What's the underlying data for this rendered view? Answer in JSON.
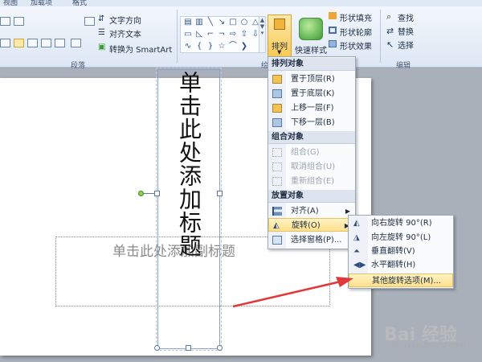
{
  "tabs": [
    "视图",
    "加载项",
    "格式"
  ],
  "ribbon": {
    "paragraph": {
      "text_direction": "文字方向",
      "align_text": "对齐文本",
      "convert_smartart": "转换为 SmartArt",
      "group_label": "段落"
    },
    "drawing": {
      "arrange": "排列",
      "quick_styles": "快速样式",
      "shape_fill": "形状填充",
      "shape_outline": "形状轮廓",
      "shape_effects": "形状效果",
      "group_label": "绘"
    },
    "editing": {
      "find": "查找",
      "replace": "替换",
      "select": "选择",
      "group_label": "编辑"
    }
  },
  "slide": {
    "title_placeholder": "单击此处添加标题",
    "subtitle_placeholder": "单击此处添加副标题"
  },
  "menu": {
    "sections": [
      {
        "header": "排列对象",
        "items": [
          {
            "label": "置于顶层(R)",
            "icon": "bring-to-front-icon",
            "enabled": true
          },
          {
            "label": "置于底层(K)",
            "icon": "send-to-back-icon",
            "enabled": true
          },
          {
            "label": "上移一层(F)",
            "icon": "bring-forward-icon",
            "enabled": true
          },
          {
            "label": "下移一层(B)",
            "icon": "send-backward-icon",
            "enabled": true
          }
        ]
      },
      {
        "header": "组合对象",
        "items": [
          {
            "label": "组合(G)",
            "icon": "group-icon",
            "enabled": false
          },
          {
            "label": "取消组合(U)",
            "icon": "ungroup-icon",
            "enabled": false
          },
          {
            "label": "重新组合(E)",
            "icon": "regroup-icon",
            "enabled": false
          }
        ]
      },
      {
        "header": "放置对象",
        "items": [
          {
            "label": "对齐(A)",
            "icon": "align-icon",
            "enabled": true,
            "submenu": true
          },
          {
            "label": "旋转(O)",
            "icon": "rotate-icon",
            "enabled": true,
            "submenu": true,
            "highlighted": true
          },
          {
            "label": "选择窗格(P)...",
            "icon": "selection-pane-icon",
            "enabled": true
          }
        ]
      }
    ]
  },
  "rotate_submenu": {
    "items": [
      {
        "label": "向右旋转 90°(R)",
        "icon": "rotate-right-icon"
      },
      {
        "label": "向左旋转 90°(L)",
        "icon": "rotate-left-icon"
      },
      {
        "label": "垂直翻转(V)",
        "icon": "flip-vertical-icon"
      },
      {
        "label": "水平翻转(H)",
        "icon": "flip-horizontal-icon"
      },
      {
        "label": "其他旋转选项(M)...",
        "icon": "",
        "highlighted": true
      }
    ]
  },
  "watermark": {
    "brand": "Bai 经验",
    "url": "jingyan.baidu.com"
  },
  "colors": {
    "ribbon_bg": "#dde7f4",
    "highlight": "#fde08c",
    "annotation_arrow": "#e0383b"
  }
}
